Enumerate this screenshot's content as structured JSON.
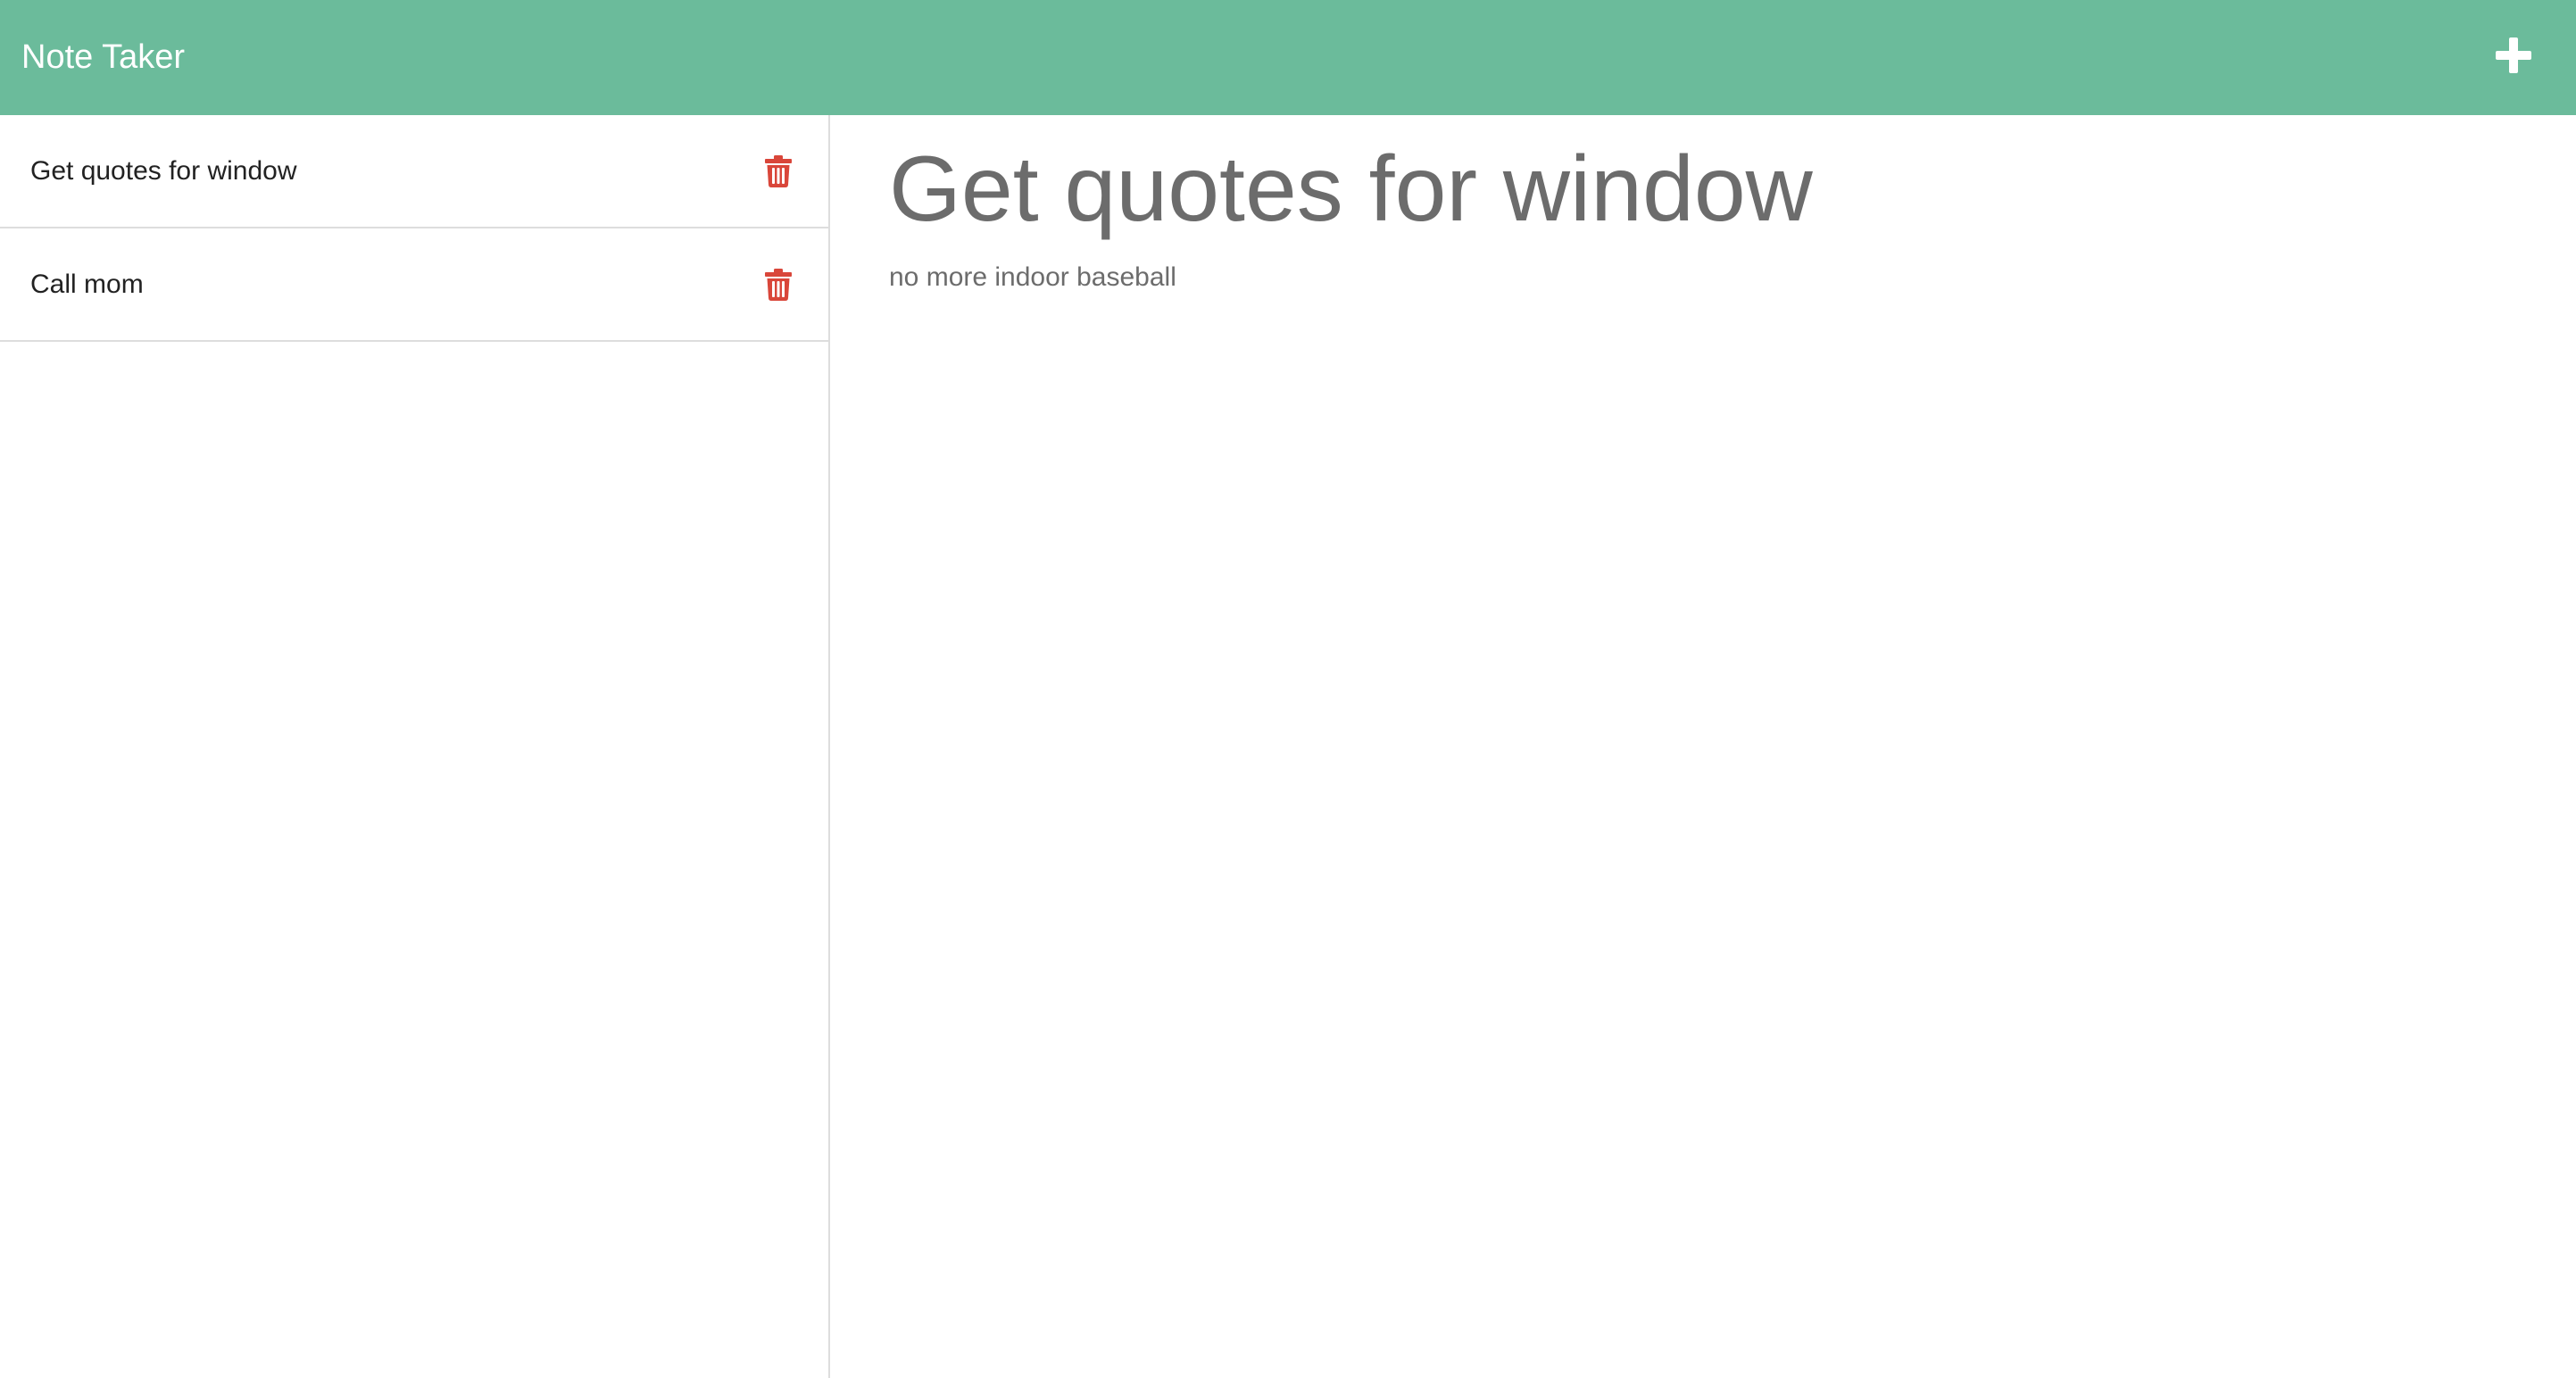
{
  "app": {
    "title": "Note Taker"
  },
  "header": {
    "new_note_icon": "plus-icon"
  },
  "sidebar": {
    "notes": [
      {
        "title": "Get quotes for window",
        "delete_icon": "trash-icon"
      },
      {
        "title": "Call mom",
        "delete_icon": "trash-icon"
      }
    ]
  },
  "editor": {
    "title_value": "Get quotes for window",
    "body_value": "no more indoor baseball"
  },
  "colors": {
    "navbar": "#6bbb9b",
    "delete_icon": "#d9463a",
    "editor_text": "#6c6c6c",
    "border": "#dddddd"
  }
}
